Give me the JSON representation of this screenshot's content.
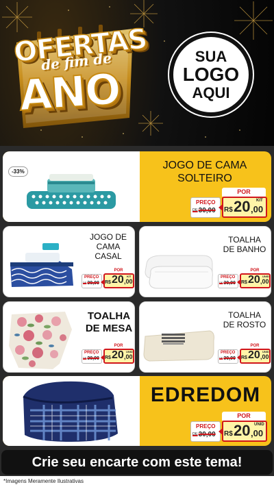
{
  "header": {
    "title_line1": "OFERTAS",
    "title_line2": "de fim de",
    "title_line3": "ANO",
    "logo": {
      "line1": "SUA",
      "line2": "LOGO",
      "line3": "AQUI"
    }
  },
  "products": [
    {
      "id": "jogo-cama-solteiro",
      "name_l1": "JOGO DE CAMA",
      "name_l2": "SOLTEIRO",
      "name_l3": "",
      "badge": "-33%",
      "por": "POR",
      "preco": "PREÇO",
      "de": "DE",
      "old_price": "30,00",
      "rs": "R$",
      "price_int": "20",
      "price_dec": ",00",
      "unit": "KIT"
    },
    {
      "id": "jogo-cama-casal",
      "name_l1": "JOGO DE",
      "name_l2": "CAMA",
      "name_l3": "CASAL",
      "por": "POR",
      "preco": "PREÇO",
      "de": "DE",
      "old_price": "30,00",
      "rs": "R$",
      "price_int": "20",
      "price_dec": ",00",
      "unit": "KIT"
    },
    {
      "id": "toalha-banho",
      "name_l1": "TOALHA",
      "name_l2": "DE BANHO",
      "name_l3": "",
      "por": "POR",
      "preco": "PREÇO",
      "de": "DE",
      "old_price": "30,00",
      "rs": "R$",
      "price_int": "20",
      "price_dec": ",00",
      "unit": "UNID"
    },
    {
      "id": "toalha-mesa",
      "name_l1": "TOALHA",
      "name_l2": "DE MESA",
      "name_l3": "",
      "por": "POR",
      "preco": "PREÇO",
      "de": "DE",
      "old_price": "30,00",
      "rs": "R$",
      "price_int": "20",
      "price_dec": ",00",
      "unit": "UNID"
    },
    {
      "id": "toalha-rosto",
      "name_l1": "TOALHA",
      "name_l2": "DE ROSTO",
      "name_l3": "",
      "por": "POR",
      "preco": "PREÇO",
      "de": "DE",
      "old_price": "30,00",
      "rs": "R$",
      "price_int": "20",
      "price_dec": ",00",
      "unit": "UNID"
    },
    {
      "id": "edredom",
      "name_l1": "EDREDOM",
      "name_l2": "",
      "name_l3": "",
      "por": "POR",
      "preco": "PREÇO",
      "de": "DE",
      "old_price": "30,00",
      "rs": "R$",
      "price_int": "20",
      "price_dec": ",00",
      "unit": "UNID"
    }
  ],
  "footer": {
    "cta": "Crie seu encarte com este tema!",
    "note": "*Imagens Meramente Ilustrativas"
  },
  "colors": {
    "yellow": "#f7c21b",
    "red": "#d0151b",
    "gold": "#c78a12",
    "dark": "#111111"
  }
}
